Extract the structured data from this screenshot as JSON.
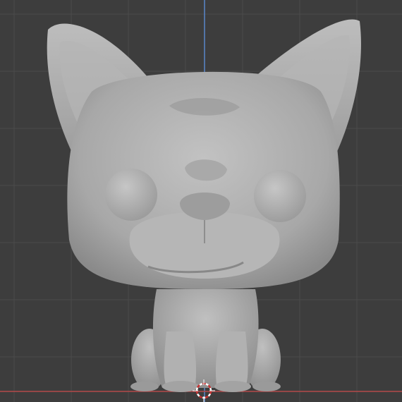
{
  "app": {
    "type": "3d-viewport"
  },
  "viewport": {
    "view": "front-orthographic",
    "background_color": "#3d3d3d",
    "grid": {
      "visible": true,
      "line_color": "#4a4a4a"
    },
    "axes": {
      "z_axis_color": "#5a86c9",
      "x_axis_color": "#b34a4a"
    },
    "model": {
      "subject": "french-bulldog-figurine",
      "material_color": "#a7a7a7"
    },
    "cursor": {
      "name": "3d-cursor",
      "colors": [
        "#c83232",
        "#ffffff"
      ]
    }
  }
}
